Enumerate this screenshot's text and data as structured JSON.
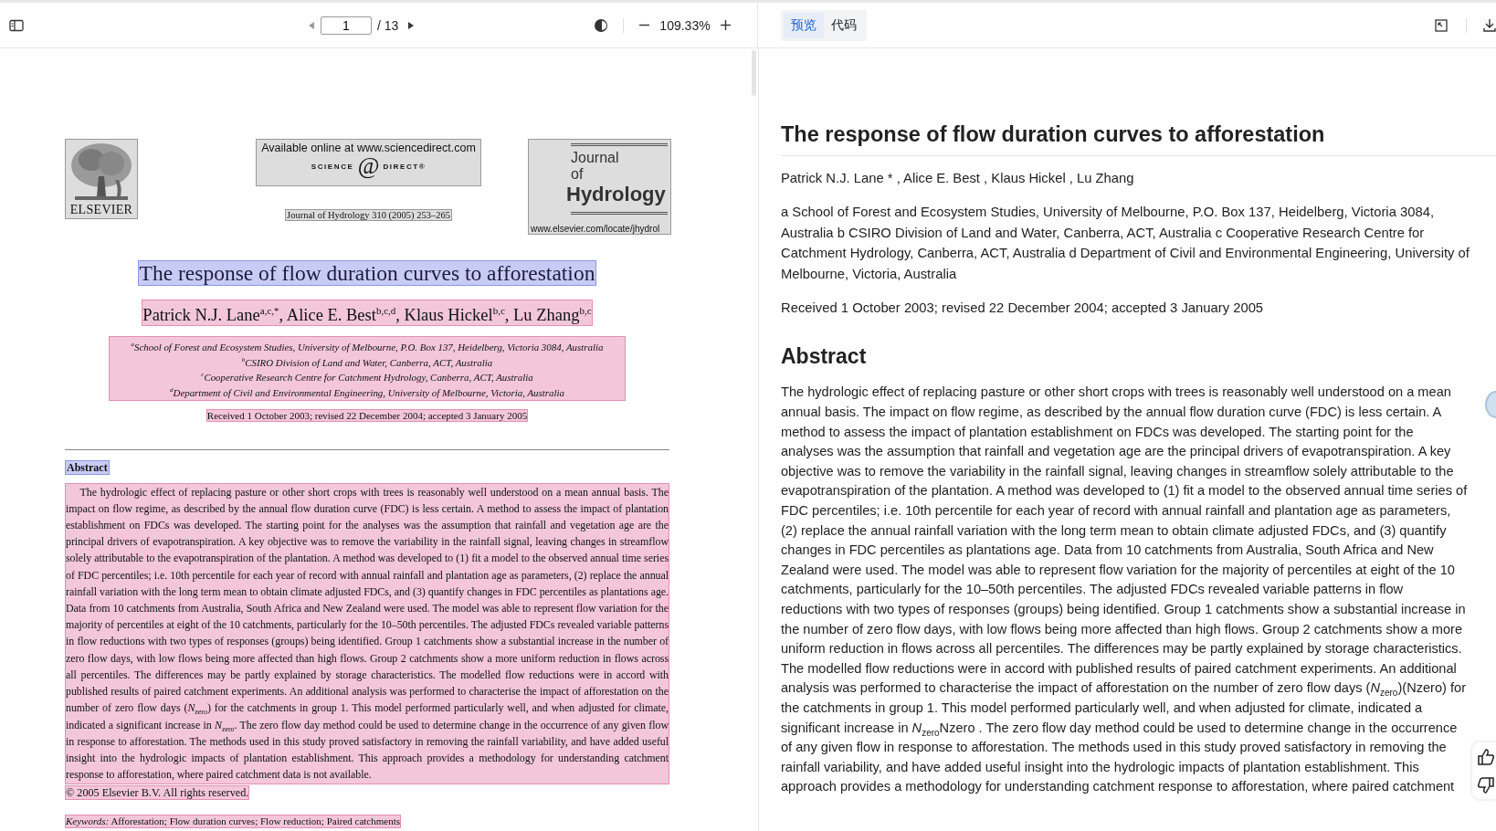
{
  "toolbar": {
    "page_input": "1",
    "page_total": "/ 13",
    "zoom": "109.33%"
  },
  "view_tabs": [
    {
      "label": "预览",
      "selected": true
    },
    {
      "label": "代码",
      "selected": false
    }
  ],
  "pdf_page": {
    "elsevier": "ELSEVIER",
    "banner": "Available online at www.sciencedirect.com",
    "sd_logo": [
      "SCIENCE",
      "@",
      "DIRECT®"
    ],
    "citation": "Journal of Hydrology 310 (2005) 253–265",
    "journal_logo": [
      "Journal",
      "of",
      "Hydrology"
    ],
    "journal_url": "www.elsevier.com/locate/jhydrol",
    "title": "The response of flow duration curves to afforestation",
    "authors": "Patrick N.J. Lane$^{a,c,*}$, Alice E. Best$^{b,c,d}$, Klaus Hickel$^{b,c}$, Lu Zhang$^{b,c}$",
    "affiliations": [
      "$^{a}$School of Forest and Ecosystem Studies, University of Melbourne, P.O. Box 137, Heidelberg, Victoria 3084, Australia",
      "$^{b}$CSIRO Division of Land and Water, Canberra, ACT, Australia",
      "$^{c}$Cooperative Research Centre for Catchment Hydrology, Canberra, ACT, Australia",
      "$^{d}$Department of Civil and Environmental Engineering, University of Melbourne, Victoria, Australia"
    ],
    "received": "Received 1 October 2003; revised 22 December 2004; accepted 3 January 2005",
    "abstract_heading": "Abstract",
    "abstract": "The hydrologic effect of replacing pasture or other short crops with trees is reasonably well understood on a mean annual basis. The impact on flow regime, as described by the annual flow duration curve (FDC) is less certain. A method to assess the impact of plantation establishment on FDCs was developed. The starting point for the analyses was the assumption that rainfall and vegetation age are the principal drivers of evapotranspiration. A key objective was to remove the variability in the rainfall signal, leaving changes in streamflow solely attributable to the evapotranspiration of the plantation. A method was developed to (1) fit a model to the observed annual time series of FDC percentiles; i.e. 10th percentile for each year of record with annual rainfall and plantation age as parameters, (2) replace the annual rainfall variation with the long term mean to obtain climate adjusted FDCs, and (3) quantify changes in FDC percentiles as plantations age. Data from 10 catchments from Australia, South Africa and New Zealand were used. The model was able to represent flow variation for the majority of percentiles at eight of the 10 catchments, particularly for the 10–50th percentiles. The adjusted FDCs revealed variable patterns in flow reductions with two types of responses (groups) being identified. Group 1 catchments show a substantial increase in the number of zero flow days, with low flows being more affected than high flows. Group 2 catchments show a more uniform reduction in flows across all percentiles. The differences may be partly explained by storage characteristics. The modelled flow reductions were in accord with published results of paired catchment experiments. An additional analysis was performed to characterise the impact of afforestation on the number of zero flow days (*N*$_{zero}$) for the catchments in group 1. This model performed particularly well, and when adjusted for climate, indicated a significant increase in *N*$_{zero}$. The zero flow day method could be used to determine change in the occurrence of any given flow in response to afforestation. The methods used in this study proved satisfactory in removing the rainfall variability, and have added useful insight into the hydrologic impacts of plantation establishment. This approach provides a methodology for understanding catchment response to afforestation, where paired catchment data is not available.",
    "copyright": "© 2005 Elsevier B.V. All rights reserved.",
    "keywords_label": "Keywords:",
    "keywords": "Afforestation; Flow duration curves; Flow reduction; Paired catchments"
  },
  "preview": {
    "title": "The response of flow duration curves to afforestation",
    "authors": "Patrick N.J. Lane * , Alice E. Best , Klaus Hickel , Lu Zhang",
    "affiliations": "a School of Forest and Ecosystem Studies, University of Melbourne, P.O. Box 137, Heidelberg, Victoria 3084, Australia b CSIRO Division of Land and Water, Canberra, ACT, Australia c Cooperative Research Centre for Catchment Hydrology, Canberra, ACT, Australia d Department of Civil and Environmental Engineering, University of Melbourne, Victoria, Australia",
    "received": "Received 1 October 2003; revised 22 December 2004; accepted 3 January 2005",
    "abstract_heading": "Abstract",
    "abstract": "The hydrologic effect of replacing pasture or other short crops with trees is reasonably well understood on a mean annual basis. The impact on flow regime, as described by the annual flow duration curve (FDC) is less certain. A method to assess the impact of plantation establishment on FDCs was developed. The starting point for the analyses was the assumption that rainfall and vegetation age are the principal drivers of evapotranspiration. A key objective was to remove the variability in the rainfall signal, leaving changes in streamflow solely attributable to the evapotranspiration of the plantation. A method was developed to (1) fit a model to the observed annual time series of FDC percentiles; i.e. 10th percentile for each year of record with annual rainfall and plantation age as parameters, (2) replace the annual rainfall variation with the long term mean to obtain climate adjusted FDCs, and (3) quantify changes in FDC percentiles as plantations age. Data from 10 catchments from Australia, South Africa and New Zealand were used. The model was able to represent flow variation for the majority of percentiles at eight of the 10 catchments, particularly for the 10–50th percentiles. The adjusted FDCs revealed variable patterns in flow reductions with two types of responses (groups) being identified. Group 1 catchments show a substantial increase in the number of zero flow days, with low flows being more affected than high flows. Group 2 catchments show a more uniform reduction in flows across all percentiles. The differences may be partly explained by storage characteristics. The modelled flow reductions were in accord with published results of paired catchment experiments. An additional analysis was performed to characterise the impact of afforestation on the number of zero flow days (*N*$_{zero}$)(Nzero) for the catchments in group 1. This model performed particularly well, and when adjusted for climate, indicated a significant increase in *N*$_{zero}$Nzero . The zero flow day method could be used to determine change in the occurrence of any given flow in response to afforestation. The methods used in this study proved satisfactory in removing the rainfall variability, and have added useful insight into the hydrologic impacts of plantation establishment. This approach provides a methodology for understanding catchment response to afforestation, where paired catchment"
  }
}
